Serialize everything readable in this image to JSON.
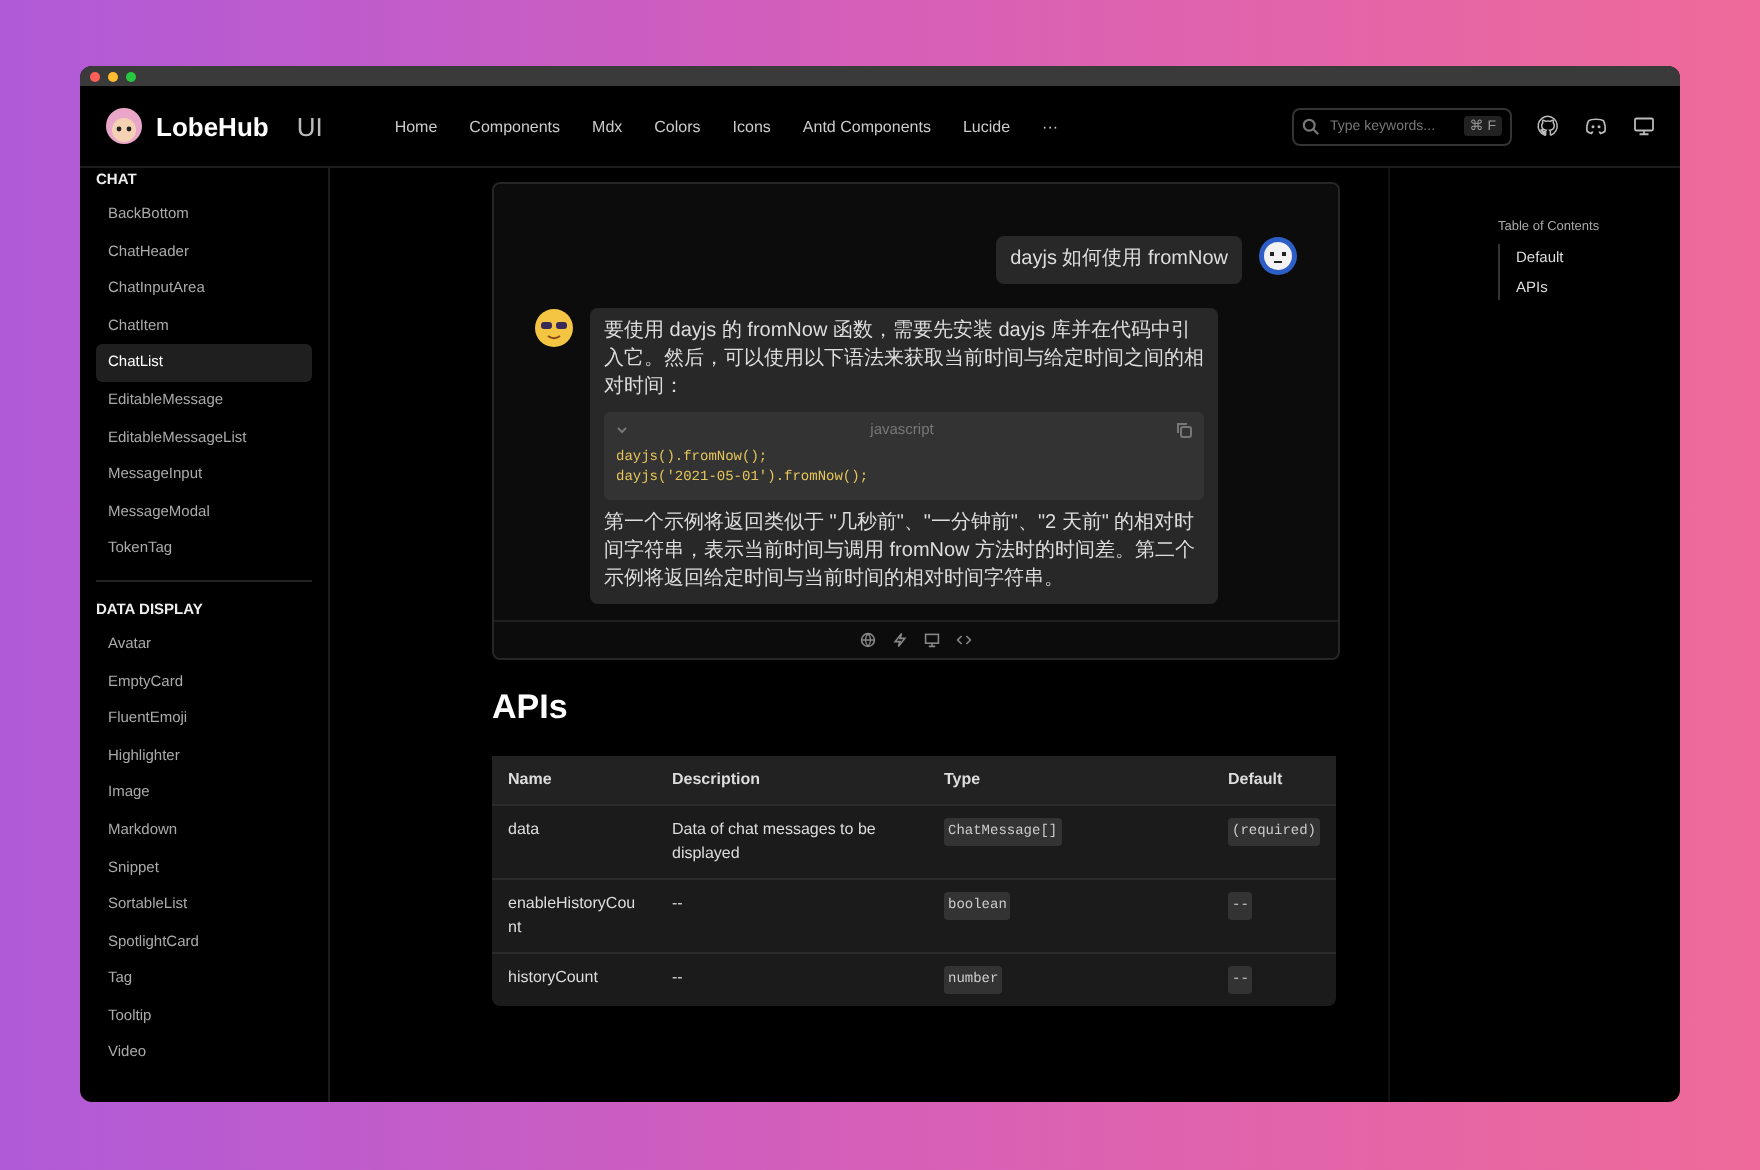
{
  "header": {
    "brand": "LobeHub",
    "product": "UI",
    "nav": [
      {
        "label": "Home"
      },
      {
        "label": "Components"
      },
      {
        "label": "Mdx"
      },
      {
        "label": "Colors"
      },
      {
        "label": "Icons"
      },
      {
        "label": "Antd Components"
      },
      {
        "label": "Lucide"
      }
    ],
    "more": "···",
    "search": {
      "placeholder": "Type keywords...",
      "shortcut": "⌘ F"
    }
  },
  "sidebar": {
    "sections": [
      {
        "title": "CHAT",
        "items": [
          {
            "label": "BackBottom",
            "selected": false
          },
          {
            "label": "ChatHeader",
            "selected": false
          },
          {
            "label": "ChatInputArea",
            "selected": false
          },
          {
            "label": "ChatItem",
            "selected": false
          },
          {
            "label": "ChatList",
            "selected": true
          },
          {
            "label": "EditableMessage",
            "selected": false
          },
          {
            "label": "EditableMessageList",
            "selected": false
          },
          {
            "label": "MessageInput",
            "selected": false
          },
          {
            "label": "MessageModal",
            "selected": false
          },
          {
            "label": "TokenTag",
            "selected": false
          }
        ]
      },
      {
        "title": "DATA DISPLAY",
        "items": [
          {
            "label": "Avatar",
            "selected": false
          },
          {
            "label": "EmptyCard",
            "selected": false
          },
          {
            "label": "FluentEmoji",
            "selected": false
          },
          {
            "label": "Highlighter",
            "selected": false
          },
          {
            "label": "Image",
            "selected": false
          },
          {
            "label": "Markdown",
            "selected": false
          },
          {
            "label": "Snippet",
            "selected": false
          },
          {
            "label": "SortableList",
            "selected": false
          },
          {
            "label": "SpotlightCard",
            "selected": false
          },
          {
            "label": "Tag",
            "selected": false
          },
          {
            "label": "Tooltip",
            "selected": false
          },
          {
            "label": "Video",
            "selected": false
          }
        ]
      }
    ]
  },
  "demo": {
    "messages": [
      {
        "kind": "user",
        "blocks": [
          {
            "kind": "text",
            "text": "dayjs 如何使用 fromNow"
          }
        ]
      },
      {
        "kind": "assistant",
        "blocks": [
          {
            "kind": "text",
            "text": "要使用 dayjs 的 fromNow 函数，需要先安装 dayjs 库并在代码中引入它。然后，可以使用以下语法来获取当前时间与给定时间之间的相对时间："
          },
          {
            "kind": "code",
            "language": "javascript",
            "lines": [
              "dayjs().fromNow();",
              "dayjs('2021-05-01').fromNow();"
            ]
          },
          {
            "kind": "text",
            "text": "第一个示例将返回类似于 \"几秒前\"、\"一分钟前\"、\"2 天前\" 的相对时间字符串，表示当前时间与调用 fromNow 方法时的时间差。第二个示例将返回给定时间与当前时间的相对时间字符串。"
          }
        ]
      }
    ]
  },
  "apis": {
    "heading": "APIs",
    "columns": [
      "Name",
      "Description",
      "Type",
      "Default"
    ],
    "rows": [
      {
        "cells": [
          {
            "kind": "text",
            "text": "data"
          },
          {
            "kind": "text",
            "text": "Data of chat messages to be displayed"
          },
          {
            "kind": "code",
            "text": "ChatMessage[]"
          },
          {
            "kind": "code",
            "text": "(required)"
          }
        ]
      },
      {
        "cells": [
          {
            "kind": "text",
            "text": "enableHistoryCount"
          },
          {
            "kind": "text",
            "text": "--"
          },
          {
            "kind": "code",
            "text": "boolean"
          },
          {
            "kind": "code",
            "text": "--"
          }
        ]
      },
      {
        "cells": [
          {
            "kind": "text",
            "text": "historyCount"
          },
          {
            "kind": "text",
            "text": "--"
          },
          {
            "kind": "code",
            "text": "number"
          },
          {
            "kind": "code",
            "text": "--"
          }
        ]
      }
    ]
  },
  "toc": {
    "title": "Table of Contents",
    "items": [
      {
        "label": "Default"
      },
      {
        "label": "APIs"
      }
    ]
  }
}
